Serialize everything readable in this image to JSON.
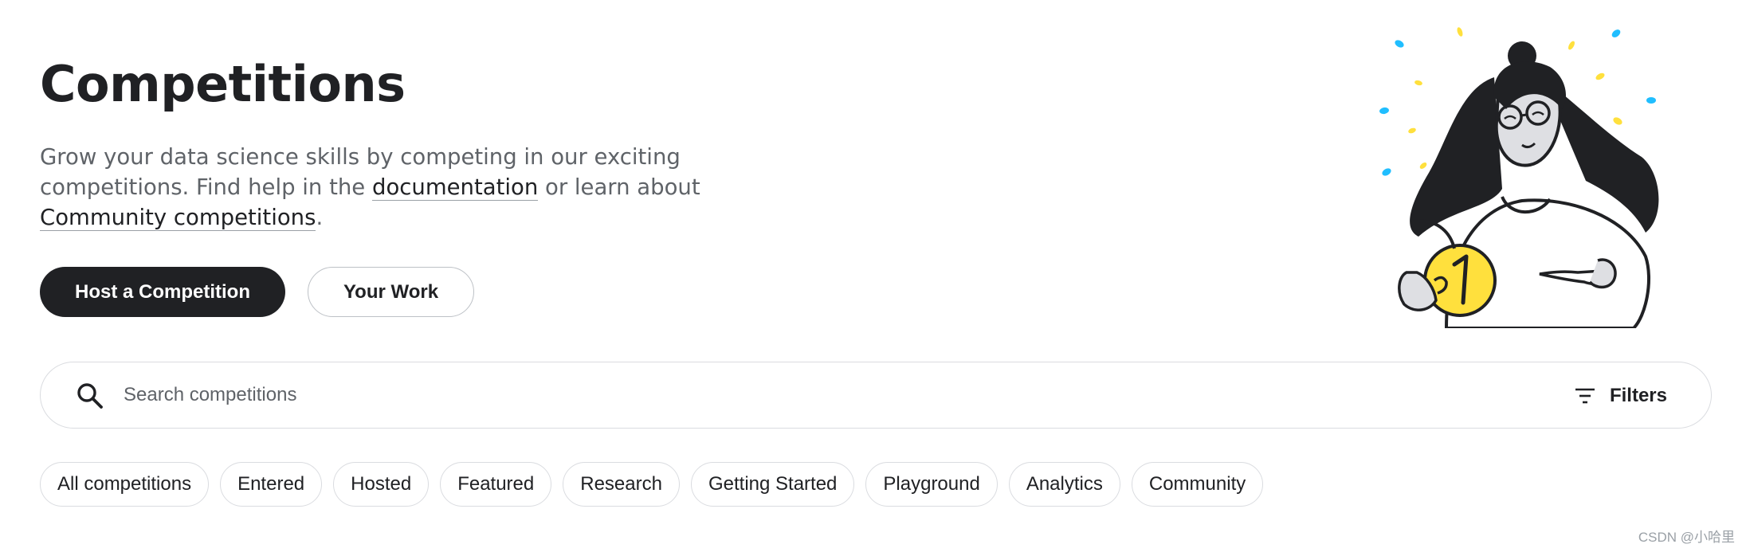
{
  "header": {
    "title": "Competitions"
  },
  "intro": {
    "text_1": "Grow your data science skills by competing in our exciting competitions. Find help in the ",
    "documentation_link": "documentation",
    "text_2": " or learn about ",
    "community_link": "Community competitions",
    "text_3": "."
  },
  "actions": {
    "host_label": "Host a Competition",
    "your_work_label": "Your Work"
  },
  "search": {
    "placeholder": "Search competitions",
    "value": "",
    "icon": "search-icon",
    "filters_label": "Filters",
    "filters_icon": "filter-lines-icon"
  },
  "chips": [
    {
      "label": "All competitions"
    },
    {
      "label": "Entered"
    },
    {
      "label": "Hosted"
    },
    {
      "label": "Featured"
    },
    {
      "label": "Research"
    },
    {
      "label": "Getting Started"
    },
    {
      "label": "Playground"
    },
    {
      "label": "Analytics"
    },
    {
      "label": "Community"
    }
  ],
  "watermark": "CSDN @小哈里",
  "colors": {
    "text_primary": "#202124",
    "text_secondary": "#5f6368",
    "button_dark": "#202124",
    "border": "#dadce0",
    "coin_yellow": "#ffe03d",
    "confetti_blue": "#20beff"
  }
}
